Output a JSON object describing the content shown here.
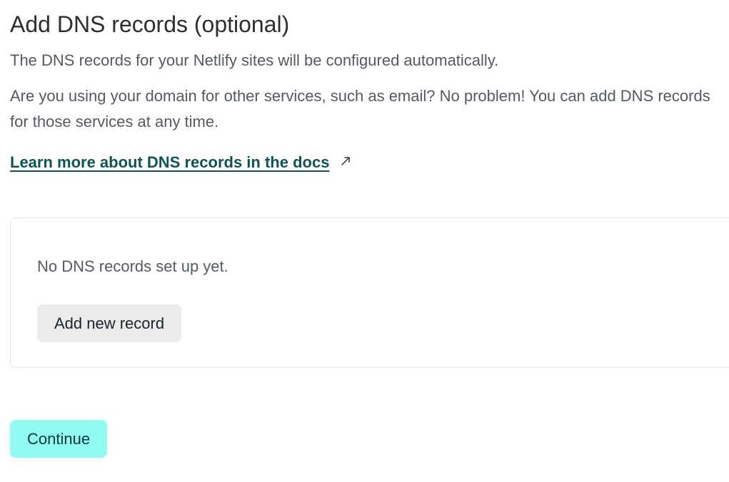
{
  "section": {
    "heading": "Add DNS records (optional)",
    "intro": "The DNS records for your Netlify sites will be configured automatically.",
    "details": "Are you using your domain for other services, such as email? No problem! You can add DNS records for those services at any time.",
    "docs_link": {
      "label": "Learn more about DNS records in the docs",
      "icon": "external-link-arrow",
      "color": "#0e5454"
    }
  },
  "records_panel": {
    "empty_message": "No DNS records set up yet.",
    "add_button_label": "Add new record"
  },
  "actions": {
    "continue_label": "Continue",
    "continue_color": "#8ffbf3"
  }
}
